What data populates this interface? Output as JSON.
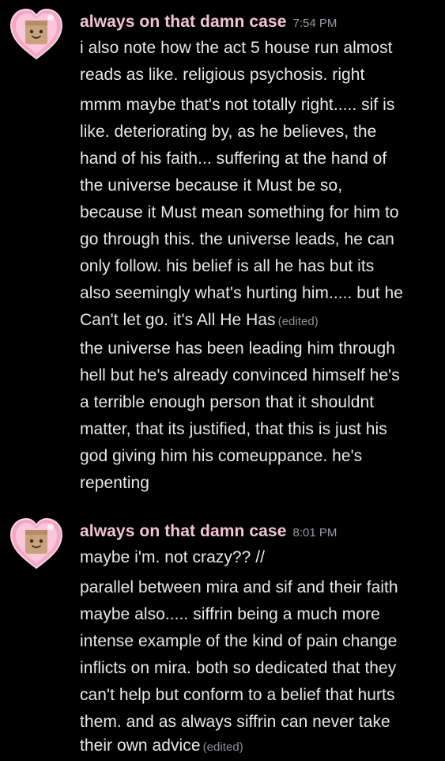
{
  "messages": [
    {
      "username": "always on that damn case",
      "timestamp": "7:54 PM",
      "avatar_icon": "cardboard-box-face-heart-avatar",
      "lines": [
        "i also note how the act 5 house run almost",
        "reads as like. religious psychosis. right",
        "mmm maybe that's not totally right..... sif is",
        "like. deteriorating by, as he believes, the",
        "hand of his faith... suffering at the hand of",
        "the universe because it Must be so,",
        "because it Must mean something for him to",
        "go through this. the universe leads, he can",
        "only follow. his belief is all he has but its",
        "also seemingly what's hurting him..... but he",
        "Can't let go. it's All He Has",
        "the universe has been leading him through",
        "hell but he's already convinced himself he's",
        "a terrible enough person that it shouldnt",
        "matter, that its justified, that this is just his",
        "god giving him his comeuppance. he's",
        "repenting"
      ],
      "edited_label": "(edited)"
    },
    {
      "username": "always on that damn case",
      "timestamp": "8:01 PM",
      "avatar_icon": "cardboard-box-face-heart-avatar",
      "lines": [
        "maybe i'm. not crazy?? //",
        "parallel between mira and sif and their faith",
        "maybe also..... siffrin being a much more",
        "intense example of the kind of pain change",
        "inflicts on mira. both so dedicated that they",
        "can't help but conform to a belief that hurts",
        "them. and as always siffrin can never take",
        "their own advice"
      ],
      "edited_label": "(edited)"
    }
  ],
  "colors": {
    "background": "#000000",
    "username": "#f3c4d2",
    "timestamp": "#9b9ca3",
    "body_text": "#e8e8ea",
    "avatar_heart": "#f4a6c4",
    "avatar_box": "#c8a27c"
  }
}
